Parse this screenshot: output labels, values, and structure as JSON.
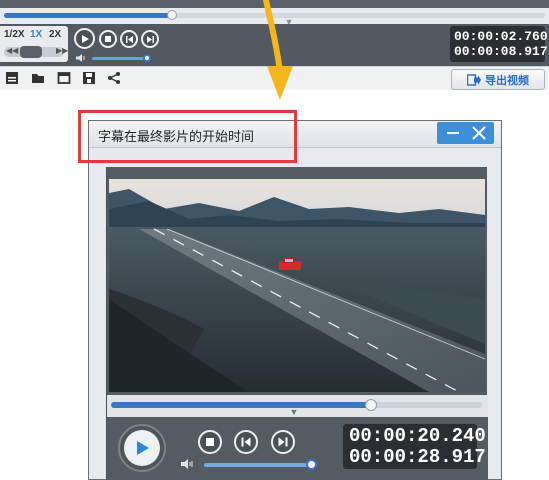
{
  "top_player": {
    "progress": 0.31,
    "speed_options": [
      "1/2X",
      "1X",
      "2X"
    ],
    "selected_speed": "1X",
    "volume": 0.95,
    "time_current": "00:00:02.760",
    "time_total": "00:00:08.917",
    "export_button_label": "导出视频",
    "toolbar_icons": [
      "subtitle-icon",
      "open-folder-icon",
      "clip-icon",
      "save-icon",
      "share-icon"
    ]
  },
  "dialog": {
    "title": "字幕在最终影片的开始时间",
    "progress": 0.7,
    "volume": 0.95,
    "time_current": "00:00:20.240",
    "time_total": "00:00:28.917"
  },
  "colors": {
    "accent": "#3a74c9",
    "highlight_border": "#e23b3b",
    "arrow": "#f4b61a",
    "control_bar": "#545b62",
    "time_display": "#2b2f34"
  }
}
